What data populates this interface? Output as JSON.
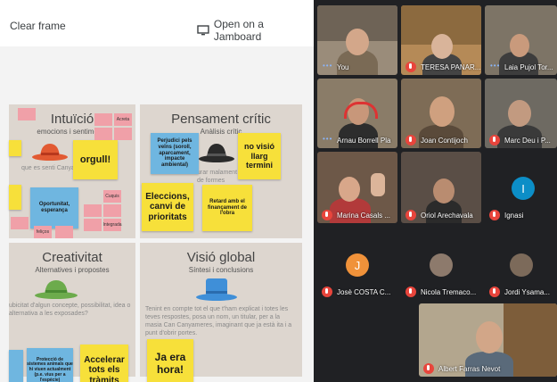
{
  "toolbar": {
    "clear_frame": "Clear frame",
    "open_jamboard": "Open on a Jamboard",
    "open_icon": "screen-share-icon"
  },
  "quadrants": {
    "intuicio": {
      "title": "Intuïció",
      "subtitle": "emocions i sentiments"
    },
    "pensament": {
      "title": "Pensament crític",
      "subtitle": "Anàlisis crític"
    },
    "creativitat": {
      "title": "Creativitat",
      "subtitle": "Alternatives i propostes"
    },
    "visio": {
      "title": "Visió global",
      "subtitle": "Síntesi i conclusions"
    }
  },
  "notes": {
    "orgull": "orgull!",
    "oportunitat": "Oportunitat, esperança",
    "perjudici": "Perjudici pels veïns (soroll, aparcament, impacte ambiental)",
    "no_visio": "no visió llarg termini",
    "eleccions": "Eleccions, canvi de prioritats",
    "retard": "Retard amb el finançament de l'obra",
    "accelerar": "Accelerar tots els tràmits",
    "ja_era": "Ja era hora!",
    "proteccio": "Protecció de sistemes animals que hi viuen actualment (p.e. vius per a l'espècie)",
    "acreta": "Acreta",
    "cuquis": "Cuquis",
    "integrada": "Integrada",
    "feliços": "feliços"
  },
  "ghost_text": {
    "intuicio": "que es senti Canyamares",
    "pensament": "urar malament la de formes",
    "creativitat": "ubicitat d'algun concepte, possibilitat, idea o alternativa a les exposades?",
    "visio": "Tenint en compte tot el que t'ham explicat i totes les teves respostes, posa un nom, un titular, per a la masia Can Canyameres, imaginant que ja està ita i a punt d'obrir portes."
  },
  "participants": [
    {
      "name": "You",
      "muted": false
    },
    {
      "name": "TERESA PANAR...",
      "muted": true
    },
    {
      "name": "Laia Pujol Tor...",
      "muted": false
    },
    {
      "name": "Arnau Borrell Pla",
      "muted": false
    },
    {
      "name": "Joan Contijoch",
      "muted": true
    },
    {
      "name": "Marc Deu i P...",
      "muted": true
    },
    {
      "name": "Marina Casals ...",
      "muted": true
    },
    {
      "name": "Oriol Arechavala",
      "muted": true
    },
    {
      "name": "Ignasi",
      "muted": true,
      "initial": "I"
    },
    {
      "name": "Josè COSTA C...",
      "muted": true,
      "initial": "J"
    },
    {
      "name": "Nicola Tremaco...",
      "muted": true
    },
    {
      "name": "Jordi Ysama...",
      "muted": true
    },
    {
      "name": "Albert Farras Nevot",
      "muted": true
    }
  ]
}
